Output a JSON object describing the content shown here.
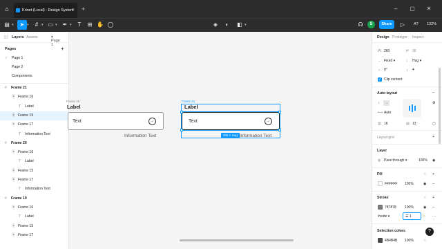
{
  "window": {
    "tab_title": "Krinet (Local) - Design System",
    "home_icon": "home-icon",
    "close_icon": "close-icon",
    "new_tab": "+"
  },
  "toolbar": {
    "zoom": "132%",
    "share_label": "Share",
    "user_initial": "S",
    "present_icon": "play-icon",
    "aa_label": "A?"
  },
  "left_panel": {
    "tabs": [
      "Layers",
      "Assets"
    ],
    "page_selector": "Page 1",
    "pages_header": "Pages",
    "pages": [
      "Page 1",
      "Page 2",
      "Components"
    ],
    "layers": [
      {
        "name": "Frame 21",
        "level": 0,
        "icon": "#"
      },
      {
        "name": "Frame 16",
        "level": 1,
        "icon": "⦿"
      },
      {
        "name": "Label",
        "level": 2,
        "icon": "T"
      },
      {
        "name": "Frame 15",
        "level": 1,
        "icon": "⦿"
      },
      {
        "name": "Frame 17",
        "level": 1,
        "icon": "⦿"
      },
      {
        "name": "Information Text",
        "level": 2,
        "icon": "T"
      },
      {
        "name": "Frame 20",
        "level": 0,
        "icon": "#"
      },
      {
        "name": "Frame 16",
        "level": 1,
        "icon": "⦿"
      },
      {
        "name": "Label",
        "level": 2,
        "icon": "T"
      },
      {
        "name": "Frame 15",
        "level": 1,
        "icon": "⦿"
      },
      {
        "name": "Frame 17",
        "level": 1,
        "icon": "⦿"
      },
      {
        "name": "Information Text",
        "level": 2,
        "icon": "T"
      },
      {
        "name": "Frame 19",
        "level": 0,
        "icon": "#"
      },
      {
        "name": "Frame 16",
        "level": 1,
        "icon": "⦿"
      },
      {
        "name": "Label",
        "level": 2,
        "icon": "T"
      },
      {
        "name": "Frame 15",
        "level": 1,
        "icon": "⦿"
      },
      {
        "name": "Frame 17",
        "level": 1,
        "icon": "⦿"
      }
    ]
  },
  "canvas": {
    "left_frame": {
      "label": "Label",
      "field_text": "Text",
      "info": "Information Text",
      "small_label": "Frame 20"
    },
    "right_frame": {
      "label": "Label",
      "field_text": "Text",
      "info": "Information Text",
      "small_label": "Frame 21"
    },
    "size_badge": "260 × Hug"
  },
  "right_panel": {
    "tabs": [
      "Design",
      "Prototype",
      "Inspect"
    ],
    "w_label": "W",
    "w_value": "260",
    "h_label": "H",
    "h_value": "36",
    "w_mode": "Fixed",
    "h_mode": "Hug",
    "rotation": "0°",
    "radius": "4",
    "clip_label": "Clip content",
    "autolayout_header": "Auto layout",
    "gap_mode": "Auto",
    "padding_h": "16",
    "padding_v": "13",
    "layout_grid_header": "Layout grid",
    "layer_header": "Layer",
    "blend_mode": "Pass through",
    "layer_opacity": "100%",
    "fill_header": "Fill",
    "fill_hex": "FFFFFF",
    "fill_opacity": "100%",
    "fill_color": "#FFFFFF",
    "stroke_header": "Stroke",
    "stroke_hex": "787878",
    "stroke_opacity": "100%",
    "stroke_color": "#787878",
    "stroke_position": "Inside",
    "stroke_weight": "1",
    "selection_colors_header": "Selection colors",
    "sel_color_hex": "4B4B4B",
    "sel_color_opacity": "100%",
    "sel_color": "#4B4B4B"
  },
  "colors": {
    "accent": "#0d99ff",
    "selection_bg": "#e5f4ff"
  },
  "help": "?"
}
